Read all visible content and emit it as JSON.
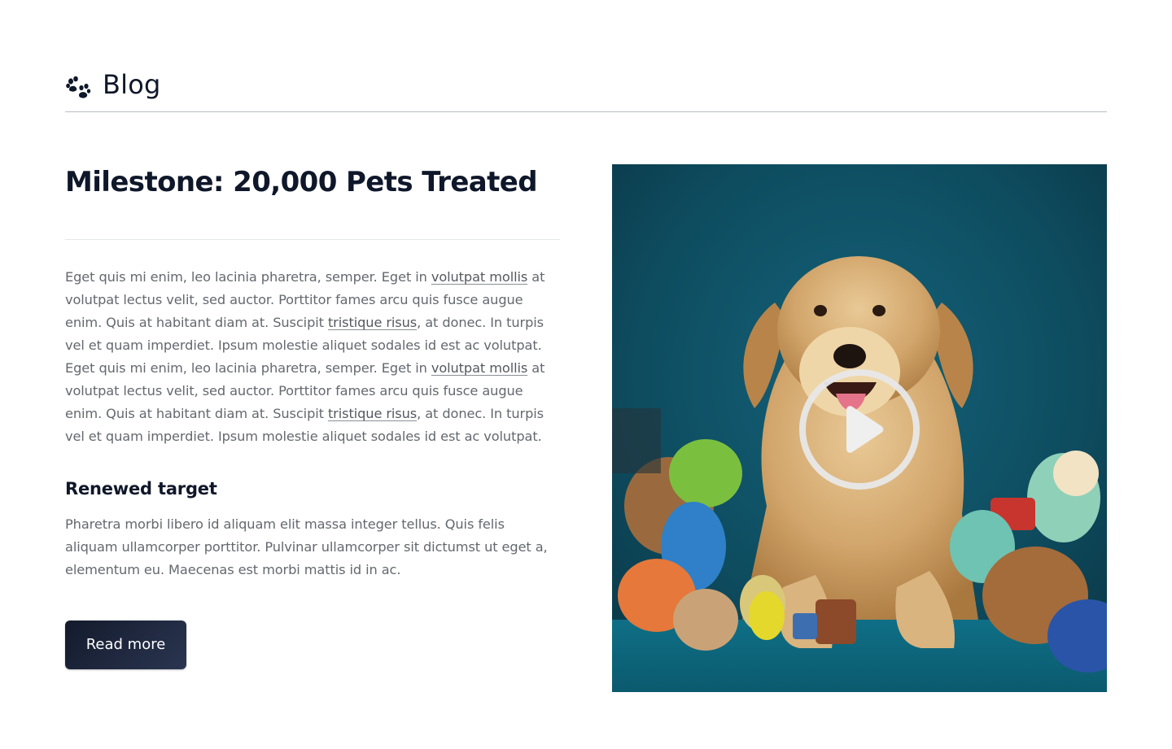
{
  "header": {
    "logo_icon": "paw-icon",
    "title": "Blog"
  },
  "article": {
    "title": "Milestone: 20,000 Pets Treated",
    "body_paragraphs": [
      {
        "segments": [
          {
            "text": "Eget quis mi enim, leo lacinia pharetra, semper. Eget in "
          },
          {
            "text": "volutpat mollis",
            "link": true
          },
          {
            "text": " at volutpat lectus velit, sed auctor. Porttitor fames arcu quis fusce augue enim. Quis at habitant diam at. Suscipit "
          },
          {
            "text": "tristique risus",
            "link": true
          },
          {
            "text": ", at donec. In turpis vel et quam imperdiet. Ipsum molestie aliquet sodales id est ac volutpat. Eget quis mi enim, leo lacinia pharetra, semper. Eget in "
          },
          {
            "text": "volutpat mollis",
            "link": true
          },
          {
            "text": " at volutpat lectus velit, sed auctor. Porttitor fames arcu quis fusce augue enim. Quis at habitant diam at. Suscipit "
          },
          {
            "text": "tristique risus",
            "link": true
          },
          {
            "text": ", at donec. In turpis vel et quam imperdiet. Ipsum molestie aliquet sodales id est ac volutpat."
          }
        ]
      }
    ],
    "section_heading": "Renewed target",
    "section_body": "Pharetra morbi libero id aliquam elit massa integer tellus. Quis felis aliquam ullamcorper porttitor. Pulvinar ullamcorper sit dictumst ut eget a, elementum eu. Maecenas est morbi mattis id in ac.",
    "cta_label": "Read more"
  },
  "video": {
    "thumbnail_subject": "golden retriever surrounded by plush toys",
    "play_icon": "play-icon"
  },
  "colors": {
    "text_primary": "#0f172a",
    "text_muted": "#64686f",
    "button_bg": "#1a2236",
    "video_bg": "#0e4a5c"
  }
}
